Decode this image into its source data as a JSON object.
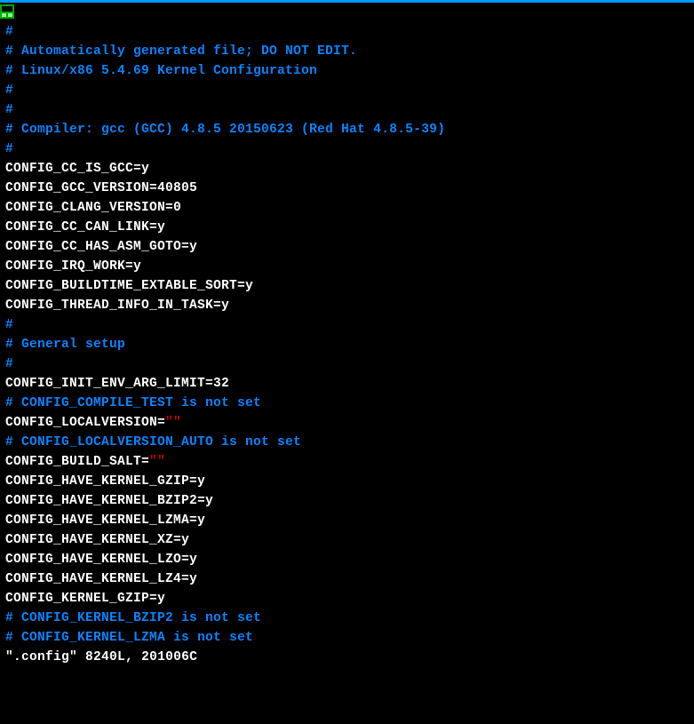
{
  "lines": [
    {
      "cls": "comment",
      "text": "#"
    },
    {
      "cls": "comment",
      "text": "# Automatically generated file; DO NOT EDIT."
    },
    {
      "cls": "comment",
      "text": "# Linux/x86 5.4.69 Kernel Configuration"
    },
    {
      "cls": "comment",
      "text": "#"
    },
    {
      "cls": "white",
      "text": ""
    },
    {
      "cls": "comment",
      "text": "#"
    },
    {
      "cls": "comment",
      "text": "# Compiler: gcc (GCC) 4.8.5 20150623 (Red Hat 4.8.5-39)"
    },
    {
      "cls": "comment",
      "text": "#"
    },
    {
      "cls": "white",
      "text": "CONFIG_CC_IS_GCC=y"
    },
    {
      "cls": "white",
      "text": "CONFIG_GCC_VERSION=40805"
    },
    {
      "cls": "white",
      "text": "CONFIG_CLANG_VERSION=0"
    },
    {
      "cls": "white",
      "text": "CONFIG_CC_CAN_LINK=y"
    },
    {
      "cls": "white",
      "text": "CONFIG_CC_HAS_ASM_GOTO=y"
    },
    {
      "cls": "white",
      "text": "CONFIG_IRQ_WORK=y"
    },
    {
      "cls": "white",
      "text": "CONFIG_BUILDTIME_EXTABLE_SORT=y"
    },
    {
      "cls": "white",
      "text": "CONFIG_THREAD_INFO_IN_TASK=y"
    },
    {
      "cls": "white",
      "text": ""
    },
    {
      "cls": "comment",
      "text": "#"
    },
    {
      "cls": "comment",
      "text": "# General setup"
    },
    {
      "cls": "comment",
      "text": "#"
    },
    {
      "cls": "white",
      "text": "CONFIG_INIT_ENV_ARG_LIMIT=32"
    },
    {
      "cls": "comment",
      "text": "# CONFIG_COMPILE_TEST is not set"
    },
    {
      "segments": [
        {
          "cls": "white",
          "text": "CONFIG_LOCALVERSION="
        },
        {
          "cls": "red",
          "text": "\"\""
        }
      ]
    },
    {
      "cls": "comment",
      "text": "# CONFIG_LOCALVERSION_AUTO is not set"
    },
    {
      "segments": [
        {
          "cls": "white",
          "text": "CONFIG_BUILD_SALT="
        },
        {
          "cls": "red",
          "text": "\"\""
        }
      ]
    },
    {
      "cls": "white",
      "text": "CONFIG_HAVE_KERNEL_GZIP=y"
    },
    {
      "cls": "white",
      "text": "CONFIG_HAVE_KERNEL_BZIP2=y"
    },
    {
      "cls": "white",
      "text": "CONFIG_HAVE_KERNEL_LZMA=y"
    },
    {
      "cls": "white",
      "text": "CONFIG_HAVE_KERNEL_XZ=y"
    },
    {
      "cls": "white",
      "text": "CONFIG_HAVE_KERNEL_LZO=y"
    },
    {
      "cls": "white",
      "text": "CONFIG_HAVE_KERNEL_LZ4=y"
    },
    {
      "cls": "white",
      "text": "CONFIG_KERNEL_GZIP=y"
    },
    {
      "cls": "comment",
      "text": "# CONFIG_KERNEL_BZIP2 is not set"
    },
    {
      "cls": "comment",
      "text": "# CONFIG_KERNEL_LZMA is not set"
    }
  ],
  "statusline": {
    "filename": "\".config\"",
    "lines_count": "8240L,",
    "chars": "201006C"
  }
}
